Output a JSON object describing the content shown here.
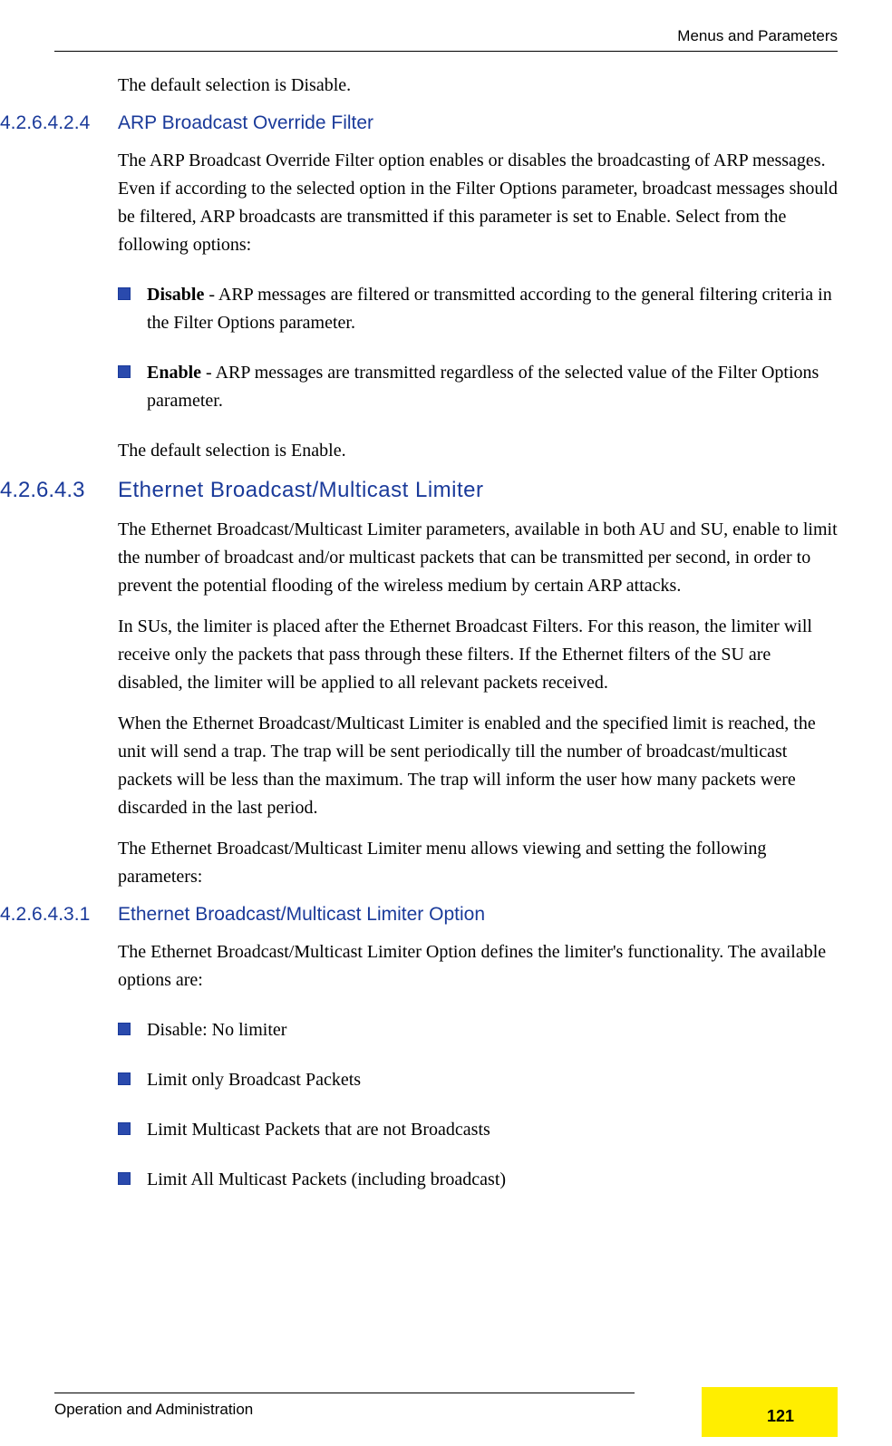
{
  "header": {
    "right": "Menus and Parameters"
  },
  "intro": "The default selection is Disable.",
  "s1": {
    "num": "4.2.6.4.2.4",
    "title": "ARP Broadcast Override Filter",
    "p1": "The ARP Broadcast Override Filter option enables or disables the broadcasting of ARP messages. Even if according to the selected option in the Filter Options parameter, broadcast messages should be filtered, ARP broadcasts are transmitted if this parameter is set to Enable. Select from the following options:",
    "b1_bold": "Disable",
    "b1_rest": " - ARP messages are filtered or transmitted according to the general filtering criteria in the Filter Options parameter.",
    "b2_bold": "Enable",
    "b2_rest": " - ARP messages are transmitted regardless of the selected value of the Filter Options parameter.",
    "p2": "The default selection is Enable."
  },
  "s2": {
    "num": "4.2.6.4.3",
    "title": "Ethernet Broadcast/Multicast Limiter",
    "p1": "The Ethernet Broadcast/Multicast Limiter parameters, available in both AU and SU, enable to limit the number of broadcast and/or multicast packets that can be transmitted per second, in order to prevent the potential flooding of the wireless medium by certain ARP attacks.",
    "p2": "In SUs, the limiter is placed after the Ethernet Broadcast Filters. For this reason, the limiter will receive only the packets that pass through these filters. If the Ethernet filters of the SU are disabled, the limiter will be applied to all relevant packets received.",
    "p3": "When the Ethernet Broadcast/Multicast Limiter is enabled and the specified limit is reached, the unit will send a trap. The trap will be sent periodically till the number of broadcast/multicast packets will be less than the maximum. The trap will inform the user how many packets were discarded in the last period.",
    "p4": "The Ethernet Broadcast/Multicast Limiter menu allows viewing and setting the following parameters:"
  },
  "s3": {
    "num": "4.2.6.4.3.1",
    "title": "Ethernet Broadcast/Multicast Limiter Option",
    "p1": "The Ethernet Broadcast/Multicast Limiter Option defines the limiter's functionality. The available options are:",
    "bullets": [
      "Disable: No limiter",
      "Limit only Broadcast Packets",
      "Limit Multicast Packets that are not Broadcasts",
      "Limit All Multicast Packets (including broadcast)"
    ]
  },
  "footer": {
    "left": "Operation and Administration",
    "page": "121"
  }
}
